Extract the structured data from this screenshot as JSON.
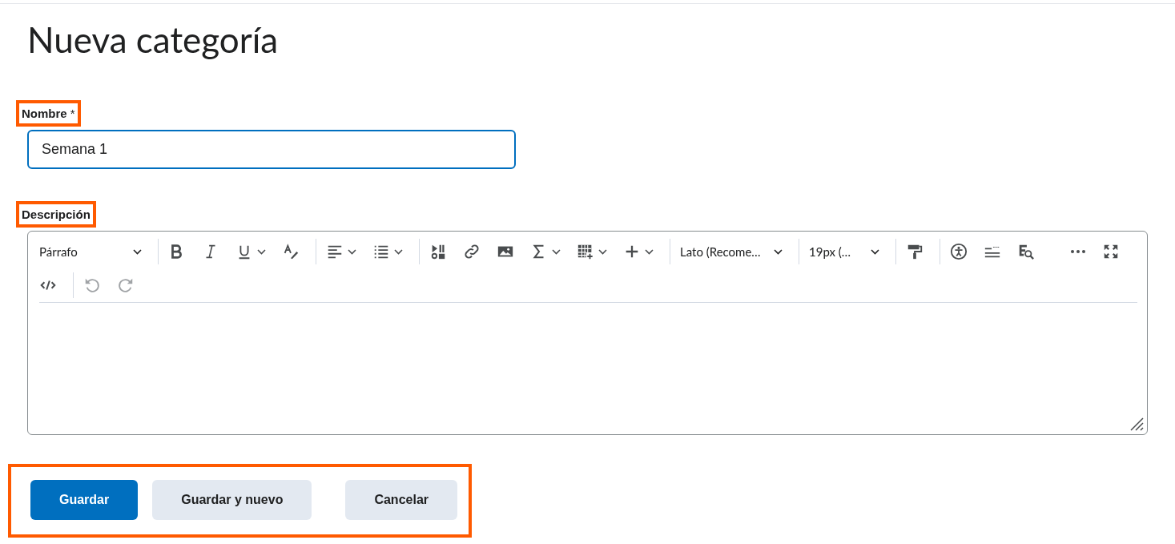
{
  "title": "Nueva categoría",
  "name_field": {
    "label": "Nombre",
    "required_mark": "*",
    "value": "Semana 1",
    "focused": true,
    "highlighted": true
  },
  "description": {
    "label": "Descripción",
    "highlighted": true,
    "toolbar": [
      {
        "kind": "select",
        "text": "Párrafo",
        "wide": true
      },
      {
        "kind": "separator"
      },
      {
        "kind": "bold",
        "has_menu": false,
        "disabled": false
      },
      {
        "kind": "italic",
        "has_menu": false,
        "disabled": false
      },
      {
        "kind": "underline",
        "has_menu": true,
        "disabled": false
      },
      {
        "kind": "text-style",
        "has_menu": false,
        "disabled": false
      },
      {
        "kind": "separator"
      },
      {
        "kind": "align",
        "has_menu": true,
        "disabled": false
      },
      {
        "kind": "list",
        "has_menu": true,
        "disabled": false
      },
      {
        "kind": "separator"
      },
      {
        "kind": "media",
        "has_menu": false,
        "disabled": false
      },
      {
        "kind": "link",
        "has_menu": false,
        "disabled": false
      },
      {
        "kind": "image",
        "has_menu": false,
        "disabled": false
      },
      {
        "kind": "sigma",
        "has_menu": true,
        "disabled": false
      },
      {
        "kind": "table",
        "has_menu": true,
        "disabled": false
      },
      {
        "kind": "plus",
        "has_menu": true,
        "disabled": false
      },
      {
        "kind": "separator"
      },
      {
        "kind": "select",
        "text": "Lato (Recome…",
        "wide": true
      },
      {
        "kind": "separator"
      },
      {
        "kind": "select",
        "text": "19px (…",
        "wide": false
      },
      {
        "kind": "separator"
      },
      {
        "kind": "paint",
        "has_menu": false,
        "disabled": false
      },
      {
        "kind": "separator"
      },
      {
        "kind": "accessibility",
        "has_menu": false,
        "disabled": false
      },
      {
        "kind": "word-count",
        "has_menu": false,
        "disabled": false
      },
      {
        "kind": "find",
        "has_menu": false,
        "disabled": false
      },
      {
        "kind": "more",
        "has_menu": false,
        "disabled": false
      },
      {
        "kind": "fullscreen",
        "has_menu": false,
        "disabled": false
      },
      {
        "kind": "break"
      },
      {
        "kind": "code",
        "has_menu": false,
        "disabled": false
      },
      {
        "kind": "separator"
      },
      {
        "kind": "undo",
        "has_menu": false,
        "disabled": true
      },
      {
        "kind": "redo",
        "has_menu": false,
        "disabled": true
      }
    ]
  },
  "buttons_highlighted": true,
  "buttons": [
    {
      "label": "Guardar",
      "primary": true
    },
    {
      "label": "Guardar y nuevo",
      "primary": false
    },
    {
      "label": "Cancelar",
      "primary": false
    }
  ]
}
